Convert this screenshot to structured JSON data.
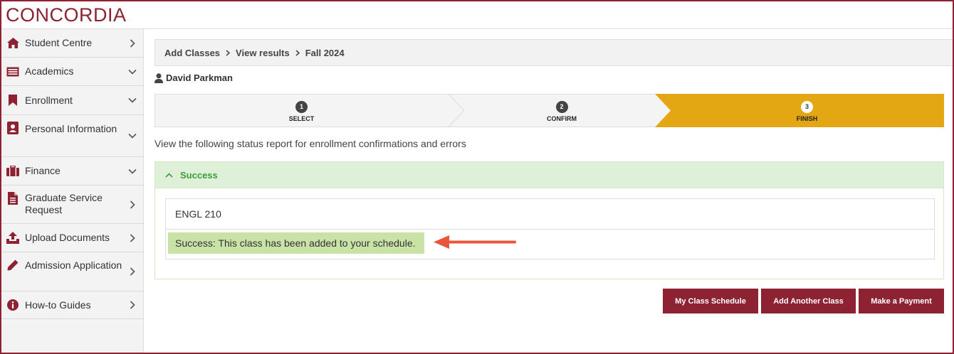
{
  "header": {
    "logo_text": "CONCORDIA",
    "brand_color": "#8c2232"
  },
  "sidebar": {
    "items": [
      {
        "label": "Student Centre",
        "icon": "home-icon",
        "chevron": "right"
      },
      {
        "label": "Academics",
        "icon": "list-icon",
        "chevron": "down"
      },
      {
        "label": "Enrollment",
        "icon": "bookmark-icon",
        "chevron": "down"
      },
      {
        "label": "Personal Information",
        "icon": "contact-card-icon",
        "chevron": "down"
      },
      {
        "label": "Finance",
        "icon": "briefcase-icon",
        "chevron": "down"
      },
      {
        "label": "Graduate Service Request",
        "icon": "document-icon",
        "chevron": "right"
      },
      {
        "label": "Upload Documents",
        "icon": "upload-icon",
        "chevron": "right"
      },
      {
        "label": "Admission Application",
        "icon": "pencil-icon",
        "chevron": "right"
      },
      {
        "label": "How-to Guides",
        "icon": "info-icon",
        "chevron": "right"
      }
    ]
  },
  "breadcrumb": {
    "items": [
      "Add Classes",
      "View results",
      "Fall 2024"
    ]
  },
  "user": {
    "name": "David Parkman",
    "icon": "user-icon"
  },
  "steps": {
    "items": [
      {
        "number": "1",
        "label": "SELECT"
      },
      {
        "number": "2",
        "label": "CONFIRM"
      },
      {
        "number": "3",
        "label": "FINISH"
      }
    ],
    "active_color": "#e3a713"
  },
  "intro_text": "View the following status report for enrollment confirmations and errors",
  "success_panel": {
    "title": "Success",
    "class_name": "ENGL 210",
    "message": "Success: This class has been added to your schedule.",
    "color": "#3c9c3c"
  },
  "actions": {
    "my_schedule": "My Class Schedule",
    "add_another": "Add Another Class",
    "make_payment": "Make a Payment"
  },
  "annotation": {
    "arrow_color": "#e8573a"
  }
}
